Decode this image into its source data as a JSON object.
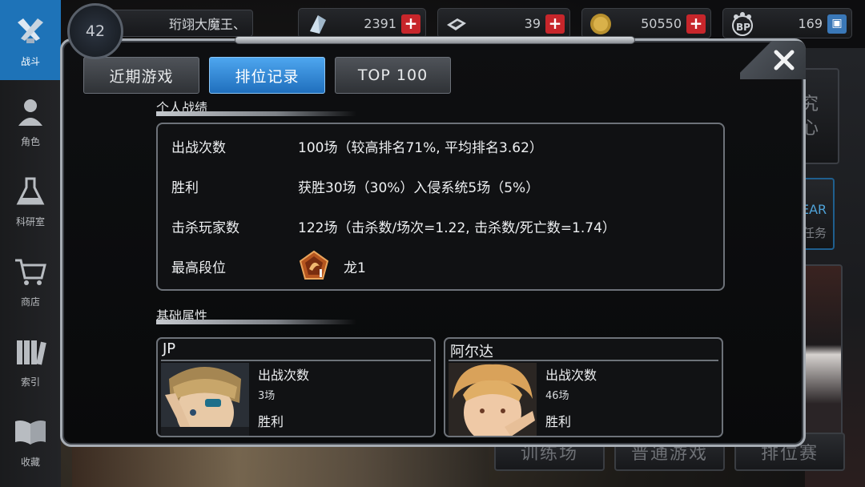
{
  "nav": {
    "items": [
      {
        "label": "战斗",
        "icon": "crossed-guns-icon"
      },
      {
        "label": "角色",
        "icon": "character-icon"
      },
      {
        "label": "科研室",
        "icon": "flask-icon"
      },
      {
        "label": "商店",
        "icon": "cart-icon"
      },
      {
        "label": "索引",
        "icon": "books-icon"
      },
      {
        "label": "收藏",
        "icon": "open-book-icon"
      }
    ]
  },
  "topbar": {
    "level": "42",
    "player_name": "珩翊大魔王、",
    "resources": [
      {
        "icon": "crystal-icon",
        "value": "2391"
      },
      {
        "icon": "ticket-icon",
        "value": "39"
      },
      {
        "icon": "gold-coin-icon",
        "value": "50550"
      },
      {
        "icon": "bp-paw-icon",
        "value": "169"
      }
    ]
  },
  "background": {
    "bottom_buttons": [
      "训练场",
      "普通游戏",
      "排位赛"
    ],
    "side_text_1": "究",
    "side_text_2": "心",
    "side_text_3": "EAR",
    "side_text_4": "任务"
  },
  "modal": {
    "tabs": [
      "近期游戏",
      "排位记录",
      "TOP 100"
    ],
    "active_tab": 1,
    "personal_section_title": "个人战绩",
    "stats": [
      {
        "label": "出战次数",
        "value": "100场（较高排名71%, 平均排名3.62）"
      },
      {
        "label": "胜利",
        "value": "获胜30场（30%）入侵系统5场（5%）"
      },
      {
        "label": "击杀玩家数",
        "value": "122场（击杀数/场次=1.22, 击杀数/死亡数=1.74）"
      },
      {
        "label": "最高段位",
        "value": "龙1"
      }
    ],
    "rank_icon": "dragon-rank-badge-icon",
    "basic_section_title": "基础属性",
    "characters": [
      {
        "name": "JP",
        "stat1_label": "出战次数",
        "stat1_value": "3场",
        "stat2_label": "胜利"
      },
      {
        "name": "阿尔达",
        "stat1_label": "出战次数",
        "stat1_value": "46场",
        "stat2_label": "胜利"
      }
    ]
  }
}
